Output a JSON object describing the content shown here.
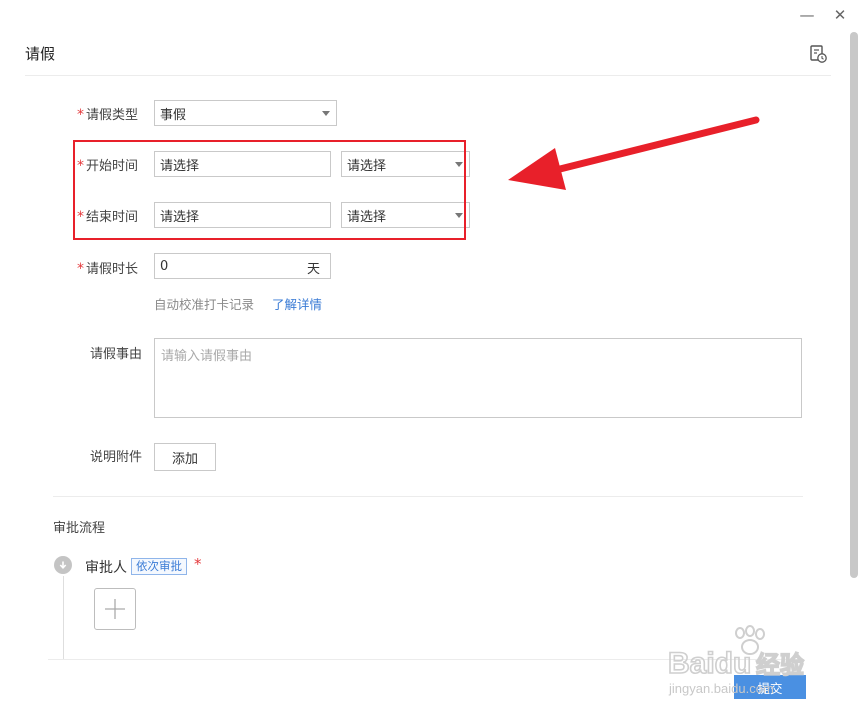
{
  "window": {
    "minimize": "—",
    "close": "✕"
  },
  "header": {
    "title": "请假",
    "history_icon": "history-doc-icon"
  },
  "form": {
    "leave_type": {
      "label": "请假类型",
      "value": "事假"
    },
    "start_time": {
      "label": "开始时间",
      "date_placeholder": "请选择",
      "period_placeholder": "请选择"
    },
    "end_time": {
      "label": "结束时间",
      "date_placeholder": "请选择",
      "period_placeholder": "请选择"
    },
    "duration": {
      "label": "请假时长",
      "value": "0",
      "unit": "天"
    },
    "auto_calibrate_hint": "自动校准打卡记录",
    "learn_more": "了解详情",
    "reason": {
      "label": "请假事由",
      "placeholder": "请输入请假事由"
    },
    "attachment": {
      "label": "说明附件",
      "add_label": "添加"
    }
  },
  "approval": {
    "section_title": "审批流程",
    "approver_label": "审批人",
    "mode_tag": "依次审批"
  },
  "footer": {
    "submit_label": "提交"
  },
  "watermark": {
    "brand": "Baidu",
    "cn": "经验",
    "url": "jingyan.baidu.com"
  },
  "colors": {
    "accent": "#4a90e2",
    "link": "#3a7bd5",
    "required": "#e4393c",
    "annotation": "#e8202a"
  }
}
